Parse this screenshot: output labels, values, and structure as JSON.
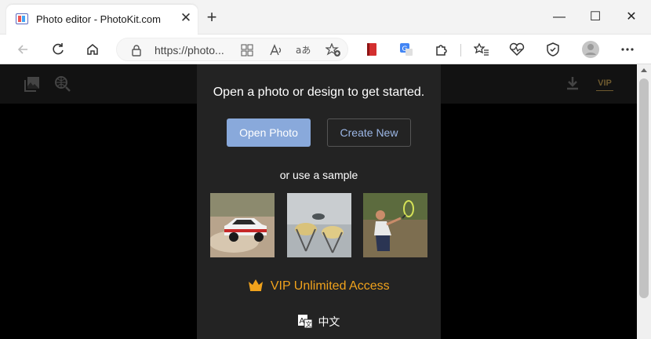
{
  "browser": {
    "tab_title": "Photo editor - PhotoKit.com",
    "tab_close": "✕",
    "new_tab": "+",
    "url": "https://photo...",
    "window_controls": [
      "—",
      "☐",
      "✕"
    ]
  },
  "app": {
    "heading": "Open a photo or design to get started.",
    "open_photo": "Open Photo",
    "create_new": "Create New",
    "sample_label": "or use a sample",
    "vip_text": "VIP Unlimited Access",
    "vip_badge": "VIP",
    "language": "中文",
    "samples": [
      "rally-car-photo",
      "champagne-glasses-photo",
      "tennis-player-photo"
    ]
  },
  "colors": {
    "accent_blue": "#89a9db",
    "vip_orange": "#f0a21c",
    "panel_bg": "#232323"
  }
}
